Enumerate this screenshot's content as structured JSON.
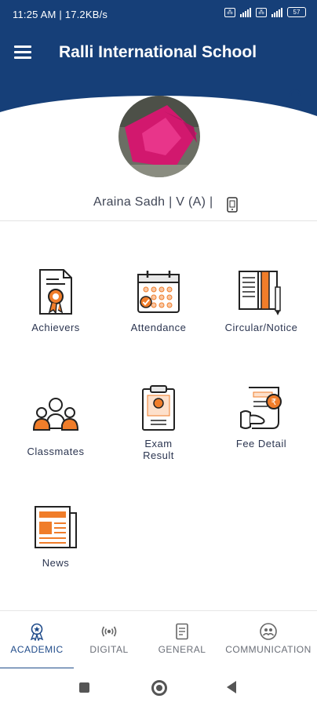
{
  "status_bar": {
    "time": "11:25 AM | 17.2KB/s",
    "battery": "57"
  },
  "header": {
    "title": "Ralli International School"
  },
  "student": {
    "name": "Araina Sadh | V (A) |"
  },
  "tiles": [
    {
      "label": "Achievers",
      "icon": "certificate-icon"
    },
    {
      "label": "Attendance",
      "icon": "calendar-icon"
    },
    {
      "label": "Circular/Notice",
      "icon": "book-icon"
    },
    {
      "label": "Classmates",
      "icon": "people-icon"
    },
    {
      "label": "Exam\nResult",
      "icon": "clipboard-icon"
    },
    {
      "label": "Fee Detail",
      "icon": "receipt-icon"
    },
    {
      "label": "News",
      "icon": "newspaper-icon"
    }
  ],
  "bottom_nav": {
    "items": [
      {
        "label": "ACADEMIC",
        "icon": "academic-icon"
      },
      {
        "label": "DIGITAL",
        "icon": "broadcast-icon"
      },
      {
        "label": "GENERAL",
        "icon": "document-icon"
      },
      {
        "label": "COMMUNICATION",
        "icon": "communication-icon"
      }
    ],
    "active": "ACADEMIC"
  },
  "colors": {
    "primary": "#163f78",
    "accent": "#f07d2a",
    "text": "#2b3550"
  }
}
